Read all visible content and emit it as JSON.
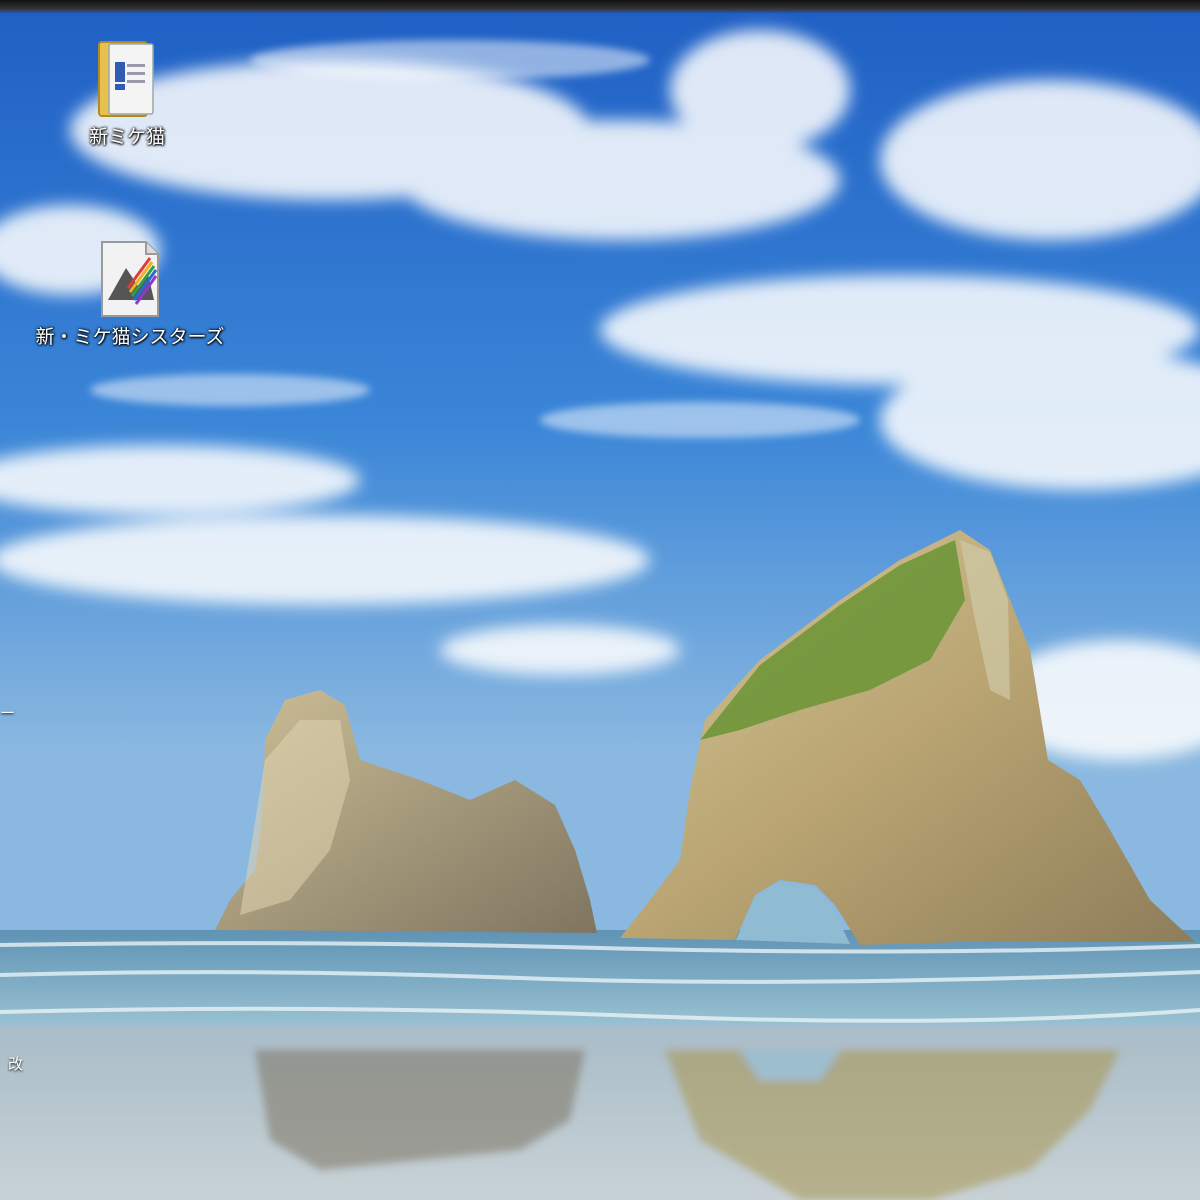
{
  "desktop": {
    "icons": [
      {
        "label": "新ミケ猫",
        "icon": "folder-icon"
      },
      {
        "label": "新・ミケ猫シスターズ",
        "icon": "document-graph-icon"
      }
    ],
    "edge_fragments": [
      "ー",
      "改"
    ]
  },
  "wallpaper": {
    "scene": "sea-arches-beach",
    "sky_color": "#2a6fcf",
    "sea_color": "#7fb1c9",
    "sand_color": "#a7b7bf",
    "rock_color": "#b8a57e",
    "grass_color": "#7a9a3a"
  }
}
